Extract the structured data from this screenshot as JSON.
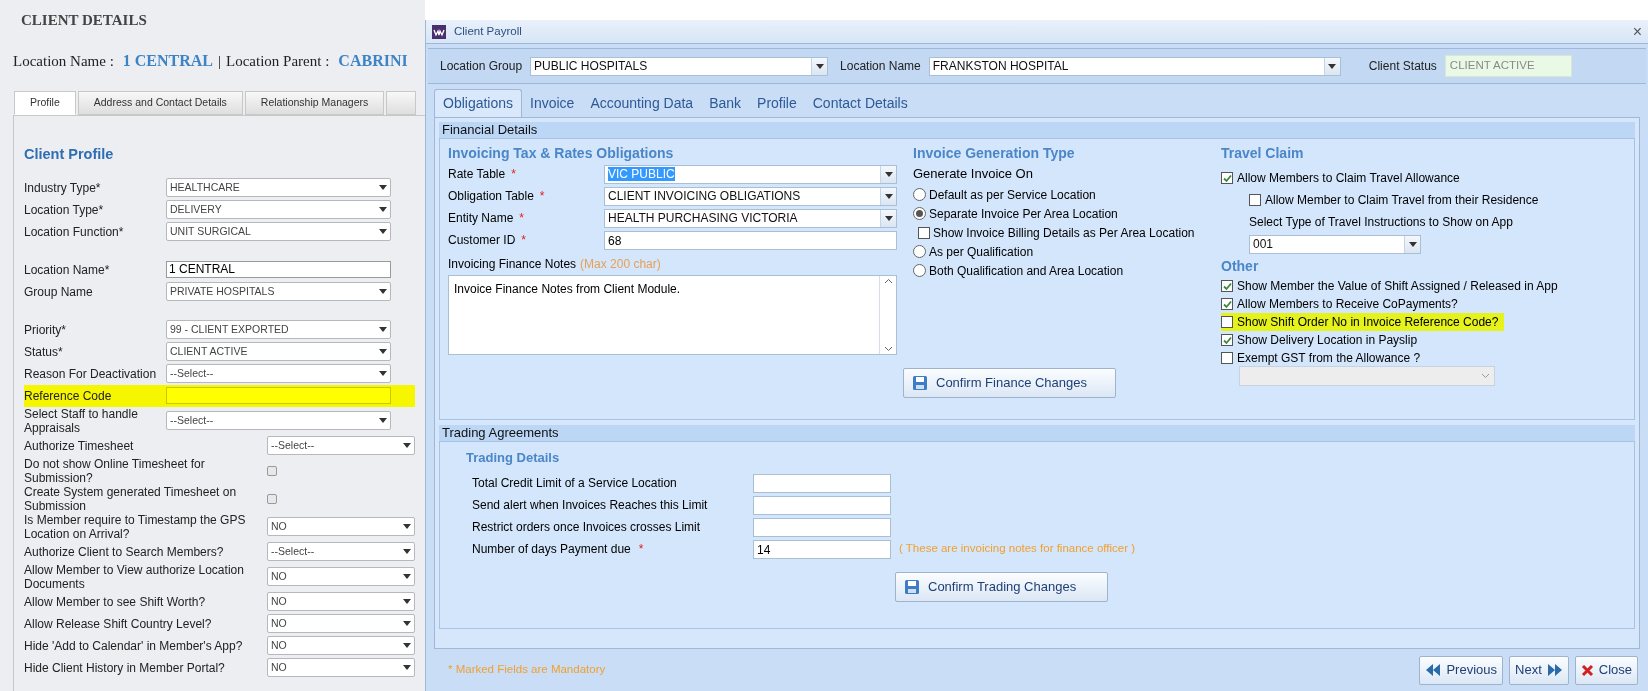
{
  "left": {
    "title": "CLIENT DETAILS",
    "location_label": "Location Name :",
    "location_name": "1 CENTRAL",
    "separator": "|",
    "parent_label": "Location Parent :",
    "location_parent": "CABRINI",
    "tabs": [
      {
        "label": "Profile",
        "selected": true
      },
      {
        "label": "Address and Contact Details",
        "selected": false
      },
      {
        "label": "Relationship Managers",
        "selected": false
      }
    ],
    "section_title": "Client Profile",
    "groups": [
      [
        {
          "label": "Industry Type*",
          "kind": "select",
          "value": "HEALTHCARE",
          "highlighted": false
        },
        {
          "label": "Location Type*",
          "kind": "select",
          "value": "DELIVERY",
          "highlighted": false
        },
        {
          "label": "Location Function*",
          "kind": "select",
          "value": "UNIT SURGICAL",
          "highlighted": false
        }
      ],
      [
        {
          "label": "Location Name*",
          "kind": "text",
          "value": "1 CENTRAL",
          "highlighted": false
        },
        {
          "label": "Group Name",
          "kind": "select",
          "value": "PRIVATE HOSPITALS",
          "highlighted": false
        }
      ],
      [
        {
          "label": "Priority*",
          "kind": "select",
          "value": "99 - CLIENT EXPORTED",
          "highlighted": false
        },
        {
          "label": "Status*",
          "kind": "select",
          "value": "CLIENT ACTIVE",
          "highlighted": false
        },
        {
          "label": "Reason For Deactivation",
          "kind": "select",
          "value": "--Select--",
          "highlighted": false
        },
        {
          "label": "Reference Code",
          "kind": "text",
          "highlighted": true
        },
        {
          "label": "Select Staff to handle Appraisals",
          "kind": "select",
          "value": "--Select--",
          "highlighted": false
        }
      ],
      [
        {
          "label": "Authorize Timesheet",
          "kind": "select",
          "value": "--Select--",
          "highlighted": false
        },
        {
          "label": "Do not show Online Timesheet for Submission?",
          "kind": "checkbox",
          "checked": false,
          "highlighted": false
        },
        {
          "label": "Create System generated Timesheet on Submission",
          "kind": "checkbox",
          "checked": false,
          "highlighted": false
        },
        {
          "label": "Is Member require to Timestamp the GPS Location on Arrival?",
          "kind": "select",
          "value": "NO",
          "highlighted": false
        },
        {
          "label": "Authorize Client to Search Members?",
          "kind": "select",
          "value": "--Select--",
          "highlighted": false
        },
        {
          "label": "Allow Member to View authorize Location Documents",
          "kind": "select",
          "value": "NO",
          "highlighted": false
        },
        {
          "label": "Allow Member to see Shift Worth?",
          "kind": "select",
          "value": "NO",
          "highlighted": false
        },
        {
          "label": "Allow Release Shift Country Level?",
          "kind": "select",
          "value": "NO",
          "highlighted": false
        },
        {
          "label": "Hide 'Add to Calendar' in Member's App?",
          "kind": "select",
          "value": "NO",
          "highlighted": false
        },
        {
          "label": "Hide Client History in Member Portal?",
          "kind": "select",
          "value": "NO",
          "highlighted": false
        }
      ]
    ]
  },
  "window": {
    "title": "Client Payroll",
    "close": "×",
    "header": [
      {
        "label": "Location Group",
        "kind": "select",
        "value": "PUBLIC HOSPITALS"
      },
      {
        "label": "Location Name",
        "kind": "select",
        "value": "FRANKSTON HOSPITAL"
      },
      {
        "label": "Client Status",
        "kind": "readonly",
        "value": "CLIENT ACTIVE"
      }
    ],
    "tabs": [
      {
        "label": "Obligations",
        "selected": true
      },
      {
        "label": "Invoice",
        "selected": false
      },
      {
        "label": "Accounting Data",
        "selected": false
      },
      {
        "label": "Bank",
        "selected": false
      },
      {
        "label": "Profile",
        "selected": false
      },
      {
        "label": "Contact Details",
        "selected": false
      }
    ],
    "financial": {
      "title": "Financial Details",
      "obligations": {
        "heading": "Invoicing Tax & Rates Obligations",
        "fields": [
          {
            "label": "Rate Table",
            "mark": "*",
            "kind": "select",
            "value": "VIC PUBLIC",
            "text_selected": true
          },
          {
            "label": "Obligation Table",
            "mark": "*",
            "kind": "select",
            "value": "CLIENT INVOICING OBLIGATIONS",
            "text_selected": false
          },
          {
            "label": "Entity Name",
            "mark": "*",
            "kind": "select",
            "value": "HEALTH PURCHASING VICTORIA",
            "text_selected": false
          },
          {
            "label": "Customer ID",
            "mark": "*",
            "kind": "text",
            "value": "68",
            "text_selected": false
          }
        ],
        "notes_label": "Invoicing Finance Notes",
        "notes_hint": "(Max 200 char)",
        "notes_value": "Invoice Finance Notes from Client Module."
      },
      "generation": {
        "heading": "Invoice Generation Type",
        "subheading": "Generate Invoice On",
        "options": [
          {
            "kind": "radio",
            "label": "Default as per Service Location",
            "selected": false
          },
          {
            "kind": "radio",
            "label": "Separate Invoice Per Area Location",
            "selected": true,
            "children": [
              {
                "kind": "checkbox",
                "label": "Show Invoice Billing Details as Per Area Location",
                "checked": false
              }
            ]
          },
          {
            "kind": "radio",
            "label": "As per Qualification",
            "selected": false
          },
          {
            "kind": "radio",
            "label": "Both Qualification and Area Location",
            "selected": false
          }
        ]
      },
      "confirm": "Confirm Finance Changes",
      "travel": {
        "heading": "Travel Claim",
        "items": [
          {
            "kind": "checkbox",
            "label": "Allow Members to Claim Travel Allowance",
            "checked": true,
            "highlighted": false,
            "children": [
              {
                "kind": "checkbox",
                "label": "Allow Member to Claim Travel from their Residence",
                "checked": false,
                "highlighted": false
              },
              {
                "kind": "label",
                "label": "Select Type of Travel Instructions to Show on App"
              },
              {
                "kind": "select",
                "value": "001"
              }
            ]
          }
        ]
      },
      "other": {
        "heading": "Other",
        "items": [
          {
            "kind": "checkbox",
            "label": "Show Member the Value of Shift Assigned / Released in App",
            "checked": true,
            "highlighted": false
          },
          {
            "kind": "checkbox",
            "label": "Allow Members to Receive CoPayments?",
            "checked": true,
            "highlighted": false
          },
          {
            "kind": "checkbox",
            "label": "Show Shift Order No in Invoice Reference Code?",
            "checked": false,
            "highlighted": true
          },
          {
            "kind": "checkbox",
            "label": "Show Delivery Location in Payslip",
            "checked": true,
            "highlighted": false
          },
          {
            "kind": "checkbox",
            "label": "Exempt GST from the Allowance ?",
            "checked": false,
            "highlighted": false
          },
          {
            "kind": "disabled_select"
          }
        ]
      }
    },
    "trading": {
      "title": "Trading Agreements",
      "heading": "Trading Details",
      "fields": [
        {
          "label": "Total Credit Limit of a Service Location"
        },
        {
          "label": "Send alert when Invoices Reaches this Limit"
        },
        {
          "label": "Restrict orders once Invoices crosses Limit"
        },
        {
          "label": "Number of days Payment due",
          "mark": "*",
          "value": "14",
          "note": "( These are invoicing notes for finance officer )"
        }
      ],
      "confirm": "Confirm Trading Changes"
    },
    "footer": {
      "note": "* Marked Fields are Mandatory",
      "buttons": [
        {
          "kind": "previous",
          "label": "Previous"
        },
        {
          "kind": "next",
          "label": "Next"
        },
        {
          "kind": "close",
          "label": "Close"
        }
      ]
    }
  }
}
